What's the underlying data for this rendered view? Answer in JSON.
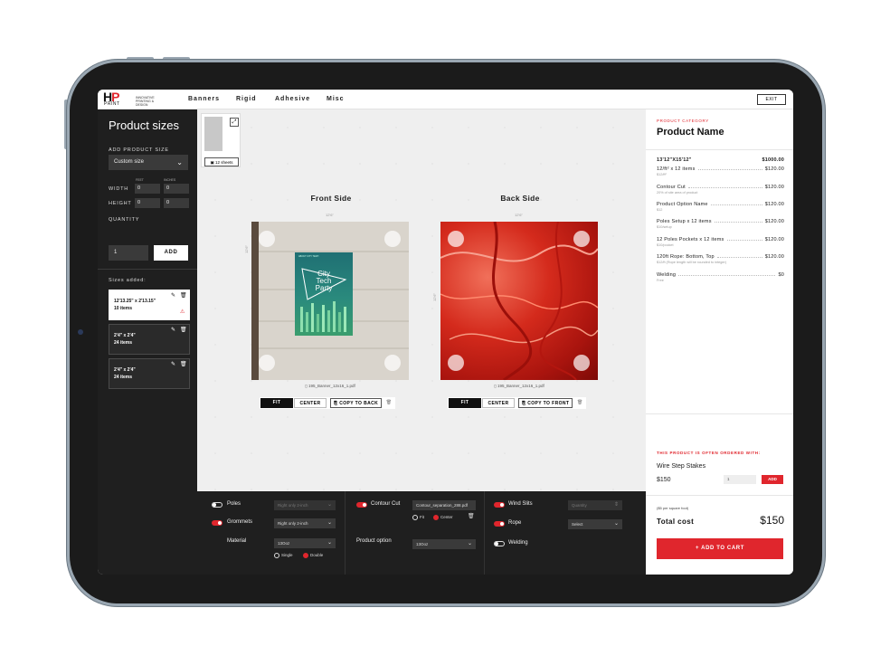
{
  "nav": {
    "brand_hp": "HP",
    "brand_print": "PRINT",
    "tagline": "INNOVATIVE PRINTING & DESIGN",
    "items": [
      "Banners",
      "Rigid",
      "Adhesive",
      "Misc"
    ],
    "exit": "EXIT"
  },
  "left": {
    "title": "Product sizes",
    "add_label": "ADD PRODUCT SIZE",
    "size_select": "Custom size",
    "feet": "FEET",
    "inches": "INCHES",
    "width_label": "WIDTH",
    "width_feet": "0",
    "width_inches": "0",
    "height_label": "HEIGHT",
    "height_feet": "0",
    "height_inches": "0",
    "quantity_label": "QUANTITY",
    "quantity": "1",
    "add_button": "ADD",
    "sizes_added": "Sizes added:",
    "sizes": [
      {
        "dims": "12'13.25\" x 2'13.15\"",
        "items": "10 items"
      },
      {
        "dims": "2'4\" x 2'4\"",
        "items": "24 items"
      },
      {
        "dims": "2'4\" x 2'4\"",
        "items": "24 items"
      }
    ]
  },
  "canvas": {
    "sheets": "12 sheets",
    "front": {
      "title": "Front Side",
      "width_dim": "12'6\"",
      "height_dim": "12'6\"",
      "file": "195_Banner_12x16_1.pdf",
      "poster_top": "ABOUT CITY TECH",
      "poster_line1": "City",
      "poster_line2": "Tech",
      "poster_line3": "Party"
    },
    "back": {
      "title": "Back Side",
      "width_dim": "12'6\"",
      "height_dim": "12'6\"",
      "file": "195_Banner_12x16_1.pdf"
    },
    "fit": "FIT",
    "center": "CENTER",
    "copy_back": "COPY TO BACK",
    "copy_front": "COPY TO FRONT"
  },
  "options": {
    "poles": "Poles",
    "poles_select": "Right only 2-inch",
    "grommets": "Grommets",
    "grommets_select": "Right only 2-inch",
    "material": "Material",
    "material_select": "13Ooz",
    "single": "Single",
    "double": "Double",
    "contour": "Contour Cut",
    "contour_file": "Contour_separation_288.pdf",
    "fit": "Fit",
    "center": "Center",
    "product_option": "Product option",
    "product_option_select": "13Ooz",
    "wind_slits": "Wind Slits",
    "quantity_placeholder": "Quantity",
    "rope": "Rope",
    "rope_select": "Select",
    "welding": "Welding"
  },
  "summary": {
    "category": "PRODUCT CATEGORY",
    "name": "Product Name",
    "size": "13'12\"X15'12\"",
    "size_total": "$1000.00",
    "lines": [
      {
        "name": "12/ft² x 12 items",
        "price": "$120.00",
        "note": "$12/ft²"
      },
      {
        "name": "Contour Cut",
        "price": "$120.00",
        "note": "20% of site area of product"
      },
      {
        "name": "Product Option Name",
        "price": "$120.00",
        "note": "$12"
      },
      {
        "name": "Poles Setup x 12 items",
        "price": "$120.00",
        "note": "$10/setup"
      },
      {
        "name": "12 Poles Pockets x 12 items",
        "price": "$120.00",
        "note": "$10/pocket"
      },
      {
        "name": "120ft Rope: Bottom, Top",
        "price": "$120.00",
        "note": "$12/ft (Rope length will be rounded to integer)"
      },
      {
        "name": "Welding",
        "price": "$0",
        "note": "Free"
      }
    ],
    "often": "THIS PRODUCT IS OFTEN ORDERED WITH:",
    "upsell_name": "Wire Step Stakes",
    "upsell_price": "$150",
    "upsell_qty": "1",
    "upsell_add": "ADD",
    "per_sqft": "($5 per square foot)",
    "total_label": "Total cost",
    "total": "$150",
    "cart": "+ ADD TO CART"
  },
  "colors": {
    "accent": "#e0262d",
    "dark": "#1f1f1f"
  }
}
